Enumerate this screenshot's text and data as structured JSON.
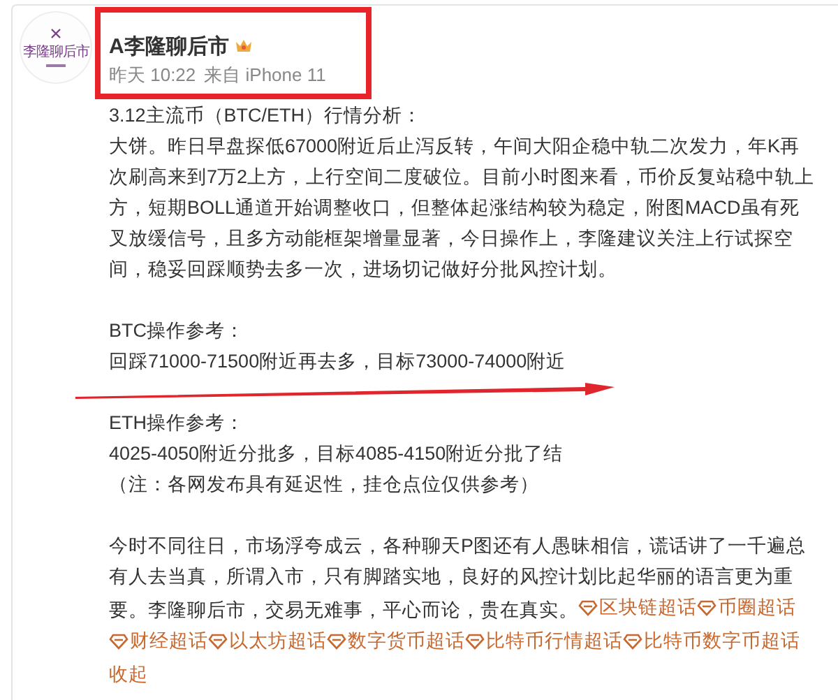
{
  "post": {
    "author": "A李隆聊后市",
    "avatar_text": "李隆聊后市",
    "time": "昨天 10:22",
    "source": "来自 iPhone 11",
    "paragraphs": [
      [
        "3.12主流币（BTC/ETH）行情分析：",
        "大饼。昨日早盘探低67000附近后止泻反转，午间大阳企稳中轨二次发力，年K再次刷高来到7万2上方，上行空间二度破位。目前小时图来看，币价反复站稳中轨上方，短期BOLL通道开始调整收口，但整体起涨结构较为稳定，附图MACD虽有死叉放缓信号，且多方动能框架增量显著，今日操作上，李隆建议关注上行试探空间，稳妥回踩顺势去多一次，进场切记做好分批风控计划。"
      ],
      [
        "BTC操作参考：",
        "回踩71000-71500附近再去多，目标73000-74000附近"
      ],
      [
        "ETH操作参考：",
        "4025-4050附近分批多，目标4085-4150附近分批了结",
        "（注：各网发布具有延迟性，挂仓点位仅供参考）"
      ],
      [
        "今时不同往日，市场浮夸成云，各种聊天P图还有人愚昧相信，谎话讲了一千遍总有人去当真，所谓入市，只有脚踏实地，良好的风控计划比起华丽的语言更为重要。李隆聊后市，交易无难事，平心而论，贵在真实。"
      ]
    ],
    "topics": [
      "区块链超话",
      "币圈超话",
      "财经超话",
      "以太坊超话",
      "数字货币超话",
      "比特币行情超话",
      "比特币数字币超话"
    ],
    "collapse_link": "收起"
  },
  "annotations": [
    {
      "kind": "box"
    },
    {
      "kind": "arrow"
    }
  ]
}
